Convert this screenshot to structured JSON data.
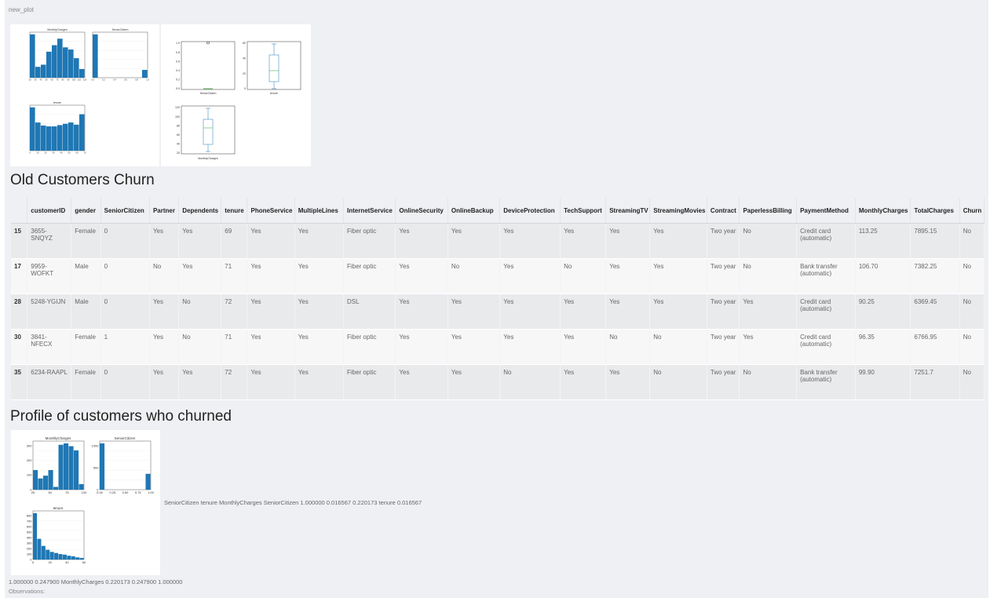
{
  "fig_label": "new_plot",
  "section_old_title": "Old Customers Churn",
  "section_profile_title": "Profile of customers who churned",
  "colors": {
    "bar": "#1f77b4",
    "box": "#1f77b4",
    "median": "#2ca02c",
    "page_bg": "#eef0f3"
  },
  "plots1": {
    "hist_monthly": {
      "title": "MonthlyCharges",
      "values": [
        1000,
        250,
        300,
        600,
        750,
        900,
        700,
        650,
        450,
        200
      ],
      "ticks": [
        "20",
        "30",
        "40",
        "50",
        "60",
        "70",
        "80",
        "90",
        "100",
        "110",
        "120"
      ]
    },
    "hist_senior": {
      "title": "SeniorCitizen",
      "values": [
        1000,
        0,
        0,
        0,
        0,
        0,
        0,
        0,
        0,
        180
      ],
      "ticks": [
        "0.0",
        "0.2",
        "0.4",
        "0.6",
        "0.8",
        "1.0"
      ]
    },
    "hist_tenure": {
      "title": "tenure",
      "values": [
        1000,
        650,
        580,
        560,
        560,
        590,
        620,
        650,
        600,
        840
      ],
      "ticks": [
        "0",
        "10",
        "20",
        "30",
        "40",
        "50",
        "60",
        "70"
      ]
    }
  },
  "plots2": {
    "box_senior": {
      "label": "SeniorCitizen",
      "yticks": [
        "0.0",
        "0.2",
        "0.4",
        "0.6",
        "0.8",
        "1.0"
      ]
    },
    "box_tenure": {
      "label": "tenure",
      "yticks": [
        "0",
        "20",
        "40",
        "60"
      ]
    },
    "box_monthly": {
      "label": "MonthlyCharges",
      "yticks": [
        "20",
        "40",
        "60",
        "80",
        "100",
        "120"
      ]
    }
  },
  "table": {
    "columns": [
      "",
      "customerID",
      "gender",
      "SeniorCitizen",
      "Partner",
      "Dependents",
      "tenure",
      "PhoneService",
      "MultipleLines",
      "InternetService",
      "OnlineSecurity",
      "OnlineBackup",
      "DeviceProtection",
      "TechSupport",
      "StreamingTV",
      "StreamingMovies",
      "Contract",
      "PaperlessBilling",
      "PaymentMethod",
      "MonthlyCharges",
      "TotalCharges",
      "Churn"
    ],
    "rows": [
      [
        "15",
        "3655-SNQYZ",
        "Female",
        "0",
        "Yes",
        "Yes",
        "69",
        "Yes",
        "Yes",
        "Fiber optic",
        "Yes",
        "Yes",
        "Yes",
        "Yes",
        "Yes",
        "Yes",
        "Two year",
        "No",
        "Credit card (automatic)",
        "113.25",
        "7895.15",
        "No"
      ],
      [
        "17",
        "9959-WOFKT",
        "Male",
        "0",
        "No",
        "Yes",
        "71",
        "Yes",
        "Yes",
        "Fiber optic",
        "Yes",
        "No",
        "Yes",
        "No",
        "Yes",
        "Yes",
        "Two year",
        "No",
        "Bank transfer (automatic)",
        "106.70",
        "7382.25",
        "No"
      ],
      [
        "28",
        "5248-YGIJN",
        "Male",
        "0",
        "Yes",
        "No",
        "72",
        "Yes",
        "Yes",
        "DSL",
        "Yes",
        "Yes",
        "Yes",
        "Yes",
        "Yes",
        "Yes",
        "Two year",
        "Yes",
        "Credit card (automatic)",
        "90.25",
        "6369.45",
        "No"
      ],
      [
        "30",
        "3841-NFECX",
        "Female",
        "1",
        "Yes",
        "No",
        "71",
        "Yes",
        "Yes",
        "Fiber optic",
        "Yes",
        "Yes",
        "Yes",
        "Yes",
        "No",
        "No",
        "Two year",
        "Yes",
        "Credit card (automatic)",
        "96.35",
        "6766.95",
        "No"
      ],
      [
        "35",
        "6234-RAAPL",
        "Female",
        "0",
        "Yes",
        "Yes",
        "72",
        "Yes",
        "Yes",
        "Fiber optic",
        "Yes",
        "Yes",
        "No",
        "Yes",
        "Yes",
        "No",
        "Two year",
        "No",
        "Bank transfer (automatic)",
        "99.90",
        "7251.7",
        "No"
      ]
    ]
  },
  "plots3": {
    "hist_monthly": {
      "title": "MonthlyCharges",
      "values": [
        140,
        80,
        100,
        140,
        20,
        320,
        330,
        310,
        280,
        40
      ],
      "yticks": [
        "0",
        "100",
        "200",
        "300"
      ],
      "xticks": [
        "25",
        "50",
        "75",
        "100"
      ]
    },
    "hist_senior": {
      "title": "SeniorCitizen",
      "values": [
        1400,
        0,
        0,
        0,
        0,
        0,
        0,
        0,
        0,
        480
      ],
      "yticks": [
        "0",
        "500",
        "1000"
      ],
      "xticks": [
        "0.00",
        "0.25",
        "0.50",
        "0.75",
        "1.00"
      ]
    },
    "hist_tenure": {
      "title": "tenure",
      "values": [
        850,
        380,
        250,
        180,
        140,
        120,
        100,
        90,
        70,
        60,
        40,
        30
      ],
      "yticks": [
        "0",
        "100",
        "200",
        "300",
        "400",
        "500",
        "600",
        "700",
        "800"
      ],
      "xticks": [
        "0",
        "20",
        "40",
        "60"
      ]
    }
  },
  "corr_text_1": "SeniorCitizen tenure MonthlyCharges SeniorCitizen 1.000000 0.016567 0.220173 tenure 0.016567",
  "corr_text_2": "1.000000 0.247900 MonthlyCharges 0.220173 0.247900 1.000000",
  "observations_label": "Observations:"
}
